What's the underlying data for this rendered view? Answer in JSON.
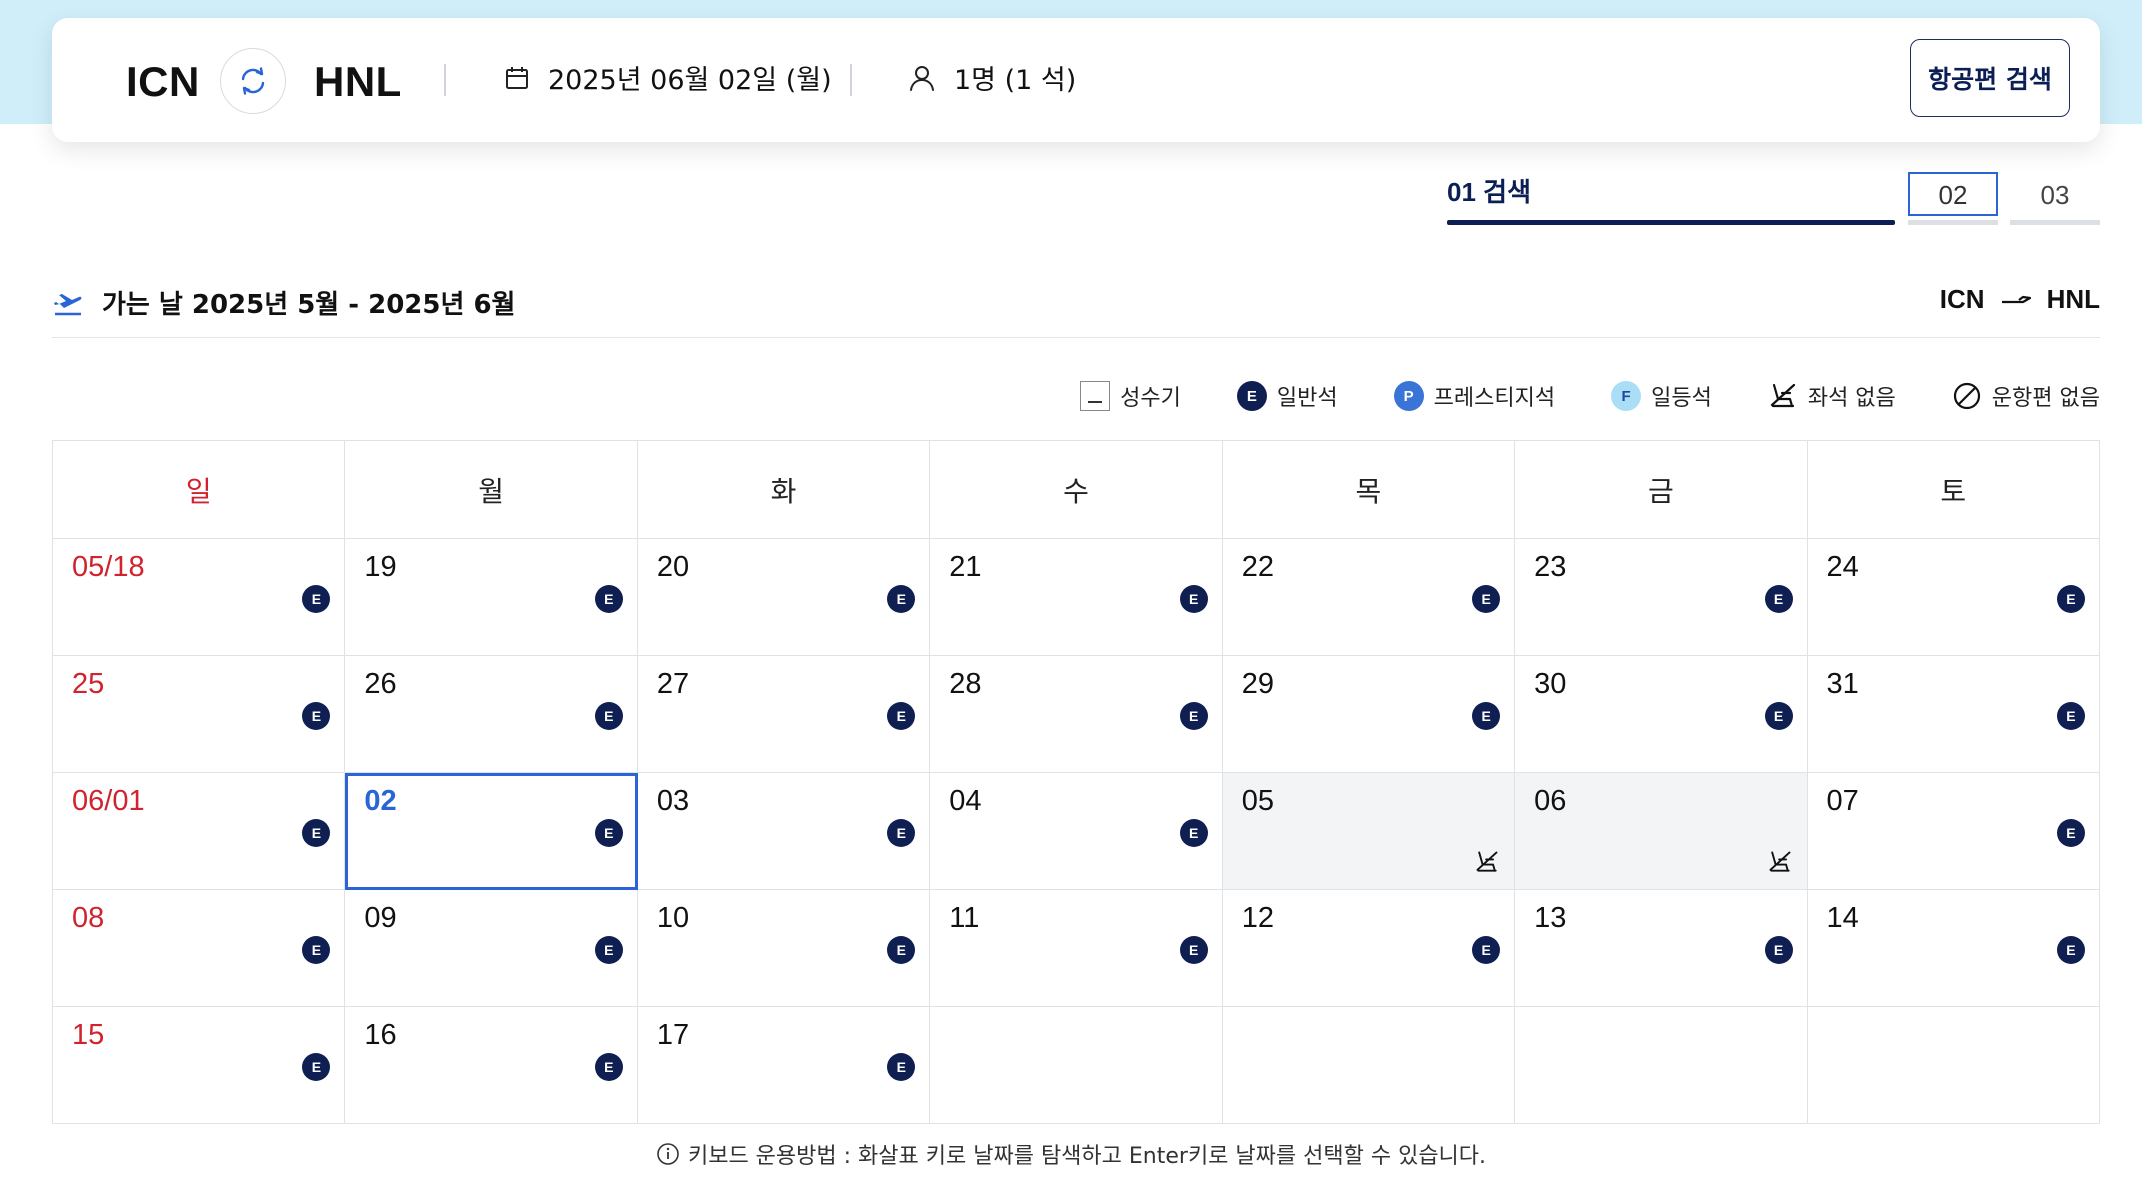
{
  "search": {
    "origin": "ICN",
    "destination": "HNL",
    "date": "2025년 06월 02일 (월)",
    "passengers": "1명 (1 석)",
    "search_button": "항공편 검색"
  },
  "steps": [
    {
      "label": "01  검색"
    },
    {
      "label": "02"
    },
    {
      "label": "03"
    }
  ],
  "departure": {
    "title": "가는 날  2025년 5월 - 2025년 6월",
    "route_from": "ICN",
    "route_to": "HNL"
  },
  "legend": {
    "peak": "성수기",
    "economy": "일반석",
    "prestige": "프레스티지석",
    "first": "일등석",
    "no_seat": "좌석 없음",
    "no_flight": "운항편 없음",
    "economy_badge": "E",
    "prestige_badge": "P",
    "first_badge": "F"
  },
  "weekdays": [
    "일",
    "월",
    "화",
    "수",
    "목",
    "금",
    "토"
  ],
  "calendar_weeks": [
    [
      {
        "d": "05/18",
        "s": "E"
      },
      {
        "d": "19",
        "s": "E"
      },
      {
        "d": "20",
        "s": "E"
      },
      {
        "d": "21",
        "s": "E"
      },
      {
        "d": "22",
        "s": "E"
      },
      {
        "d": "23",
        "s": "E"
      },
      {
        "d": "24",
        "s": "E"
      }
    ],
    [
      {
        "d": "25",
        "s": "E"
      },
      {
        "d": "26",
        "s": "E"
      },
      {
        "d": "27",
        "s": "E"
      },
      {
        "d": "28",
        "s": "E"
      },
      {
        "d": "29",
        "s": "E"
      },
      {
        "d": "30",
        "s": "E"
      },
      {
        "d": "31",
        "s": "E"
      }
    ],
    [
      {
        "d": "06/01",
        "s": "E"
      },
      {
        "d": "02",
        "s": "E",
        "selected": true
      },
      {
        "d": "03",
        "s": "E"
      },
      {
        "d": "04",
        "s": "E"
      },
      {
        "d": "05",
        "s": "noseat"
      },
      {
        "d": "06",
        "s": "noseat"
      },
      {
        "d": "07",
        "s": "E"
      }
    ],
    [
      {
        "d": "08",
        "s": "E"
      },
      {
        "d": "09",
        "s": "E"
      },
      {
        "d": "10",
        "s": "E"
      },
      {
        "d": "11",
        "s": "E"
      },
      {
        "d": "12",
        "s": "E"
      },
      {
        "d": "13",
        "s": "E"
      },
      {
        "d": "14",
        "s": "E"
      }
    ],
    [
      {
        "d": "15",
        "s": "E"
      },
      {
        "d": "16",
        "s": "E"
      },
      {
        "d": "17",
        "s": "E"
      },
      {
        "d": "",
        "s": ""
      },
      {
        "d": "",
        "s": ""
      },
      {
        "d": "",
        "s": ""
      },
      {
        "d": "",
        "s": ""
      }
    ]
  ],
  "keyboard_note": "키보드 운용방법 : 화살표 키로 날짜를 탐색하고 Enter키로 날짜를 선택할 수 있습니다.",
  "colors": {
    "navy": "#0f1f52",
    "accent_blue": "#2a64d6",
    "sunday_red": "#d0232d",
    "top_band": "#cfeefa"
  }
}
